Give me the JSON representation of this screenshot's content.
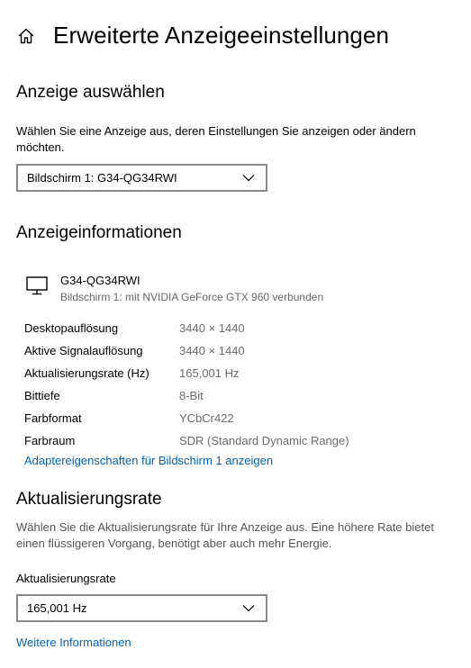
{
  "header": {
    "title": "Erweiterte Anzeigeeinstellungen",
    "home_icon": "home-icon"
  },
  "select_display": {
    "title": "Anzeige auswählen",
    "description": "Wählen Sie eine Anzeige aus, deren Einstellungen Sie anzeigen oder ändern möchten.",
    "dropdown_value": "Bildschirm 1: G34-QG34RWI"
  },
  "display_info": {
    "title": "Anzeigeinformationen",
    "monitor_icon": "monitor-icon",
    "monitor_name": "G34-QG34RWI",
    "monitor_subtitle": "Bildschirm 1: mit NVIDIA GeForce GTX 960 verbunden",
    "rows": [
      {
        "label": "Desktopauflösung",
        "value": "3440 × 1440"
      },
      {
        "label": "Aktive Signalauflösung",
        "value": "3440 × 1440"
      },
      {
        "label": "Aktualisierungsrate (Hz)",
        "value": "165,001 Hz"
      },
      {
        "label": "Bittiefe",
        "value": "8-Bit"
      },
      {
        "label": "Farbformat",
        "value": "YCbCr422"
      },
      {
        "label": "Farbraum",
        "value": "SDR (Standard Dynamic Range)"
      }
    ],
    "adapter_link": "Adaptereigenschaften für Bildschirm 1 anzeigen"
  },
  "refresh_rate": {
    "title": "Aktualisierungsrate",
    "description": "Wählen Sie die Aktualisierungsrate für Ihre Anzeige aus. Eine höhere Rate bietet einen flüssigeren Vorgang, benötigt aber auch mehr Energie.",
    "field_label": "Aktualisierungsrate",
    "dropdown_value": "165,001 Hz",
    "more_info_link": "Weitere Informationen"
  },
  "colors": {
    "link": "#0063b1",
    "border": "#8a8a8a",
    "secondary_text": "#6b6b6b"
  }
}
